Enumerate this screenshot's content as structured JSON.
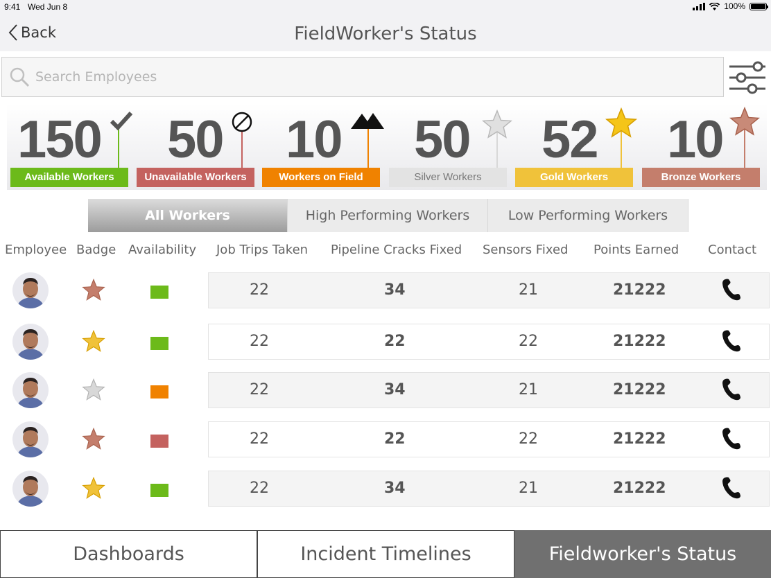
{
  "status_bar": {
    "time": "9:41",
    "date": "Wed Jun 8",
    "battery": "100%"
  },
  "nav": {
    "back_label": "Back",
    "title": "FieldWorker's Status"
  },
  "search": {
    "placeholder": "Search Employees",
    "value": ""
  },
  "stats": [
    {
      "value": "150",
      "label": "Available Workers",
      "color": "#6cba1a",
      "icon": "check-icon"
    },
    {
      "value": "50",
      "label": "Unavailable Workers",
      "color": "#c4625f",
      "icon": "prohibited-icon"
    },
    {
      "value": "10",
      "label": "Workers on Field",
      "color": "#f08200",
      "icon": "mountain-icon"
    },
    {
      "value": "50",
      "label": "Silver Workers",
      "color": "#e3e3e3",
      "icon": "silver-star-icon"
    },
    {
      "value": "52",
      "label": "Gold Workers",
      "color": "#f0c23a",
      "icon": "gold-star-icon"
    },
    {
      "value": "10",
      "label": "Bronze Workers",
      "color": "#c47e6c",
      "icon": "bronze-star-icon"
    }
  ],
  "tabs": [
    {
      "label": "All Workers",
      "active": true
    },
    {
      "label": "High Performing Workers",
      "active": false
    },
    {
      "label": "Low Performing Workers",
      "active": false
    }
  ],
  "table": {
    "columns": [
      "Employee",
      "Badge",
      "Availability",
      "Job Trips Taken",
      "Pipeline Cracks Fixed",
      "Sensors Fixed",
      "Points Earned",
      "Contact"
    ],
    "rows": [
      {
        "badge": "bronze",
        "availability": "available",
        "job_trips": "22",
        "pipeline_cracks": "34",
        "sensors": "21",
        "points": "21222"
      },
      {
        "badge": "gold",
        "availability": "available",
        "job_trips": "22",
        "pipeline_cracks": "22",
        "sensors": "22",
        "points": "21222"
      },
      {
        "badge": "silver",
        "availability": "on-field",
        "job_trips": "22",
        "pipeline_cracks": "34",
        "sensors": "21",
        "points": "21222"
      },
      {
        "badge": "bronze",
        "availability": "unavailable",
        "job_trips": "22",
        "pipeline_cracks": "22",
        "sensors": "22",
        "points": "21222"
      },
      {
        "badge": "gold",
        "availability": "available",
        "job_trips": "22",
        "pipeline_cracks": "34",
        "sensors": "21",
        "points": "21222"
      }
    ]
  },
  "colors": {
    "available": "#6cba1a",
    "unavailable": "#c4625f",
    "on-field": "#f08200",
    "gold": "#f0c23a",
    "silver": "#d8d8d8",
    "bronze": "#c47e6c"
  },
  "bottom_tabs": [
    {
      "label": "Dashboards",
      "active": false
    },
    {
      "label": "Incident Timelines",
      "active": false
    },
    {
      "label": "Fieldworker's Status",
      "active": true
    }
  ]
}
